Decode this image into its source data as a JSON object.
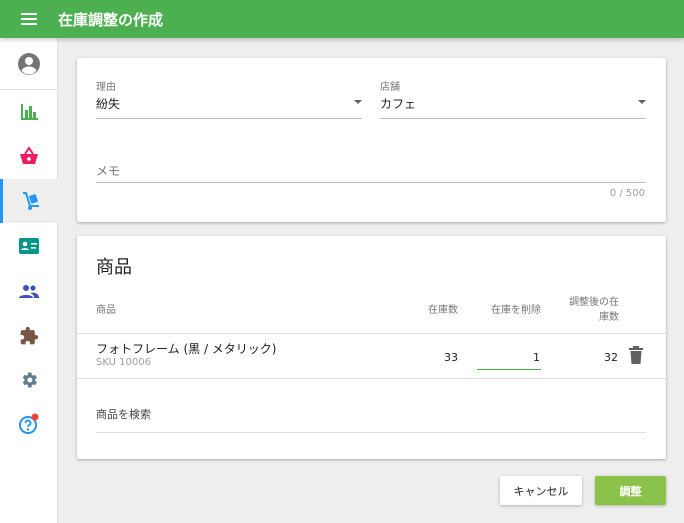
{
  "app": {
    "title": "在庫調整の作成"
  },
  "sidebar": {
    "items": [
      {
        "name": "account",
        "icon": "account-circle-icon"
      },
      {
        "name": "reports",
        "icon": "bar-chart-icon"
      },
      {
        "name": "sales",
        "icon": "basket-icon"
      },
      {
        "name": "inventory",
        "icon": "hand-truck-icon",
        "active": true
      },
      {
        "name": "customers",
        "icon": "id-card-icon"
      },
      {
        "name": "employees",
        "icon": "people-icon"
      },
      {
        "name": "apps",
        "icon": "puzzle-icon"
      },
      {
        "name": "settings",
        "icon": "gear-icon"
      },
      {
        "name": "help",
        "icon": "help-icon",
        "badge": true
      }
    ]
  },
  "form": {
    "reason": {
      "label": "理由",
      "value": "紛失"
    },
    "store": {
      "label": "店舗",
      "value": "カフェ"
    },
    "memo": {
      "label": "メモ",
      "counter": "0 / 500"
    }
  },
  "products": {
    "title": "商品",
    "columns": {
      "product": "商品",
      "in_stock": "在庫数",
      "remove": "在庫を削除",
      "after": "調整後の在庫数"
    },
    "rows": [
      {
        "name": "フォトフレーム (黒 / メタリック)",
        "sku": "SKU 10006",
        "in_stock": "33",
        "remove": "1",
        "after": "32"
      }
    ],
    "search_label": "商品を検索"
  },
  "actions": {
    "cancel": "キャンセル",
    "adjust": "調整"
  },
  "colors": {
    "primary": "#4caf50",
    "accent": "#8bc34a",
    "active_indicator": "#2196f3"
  }
}
